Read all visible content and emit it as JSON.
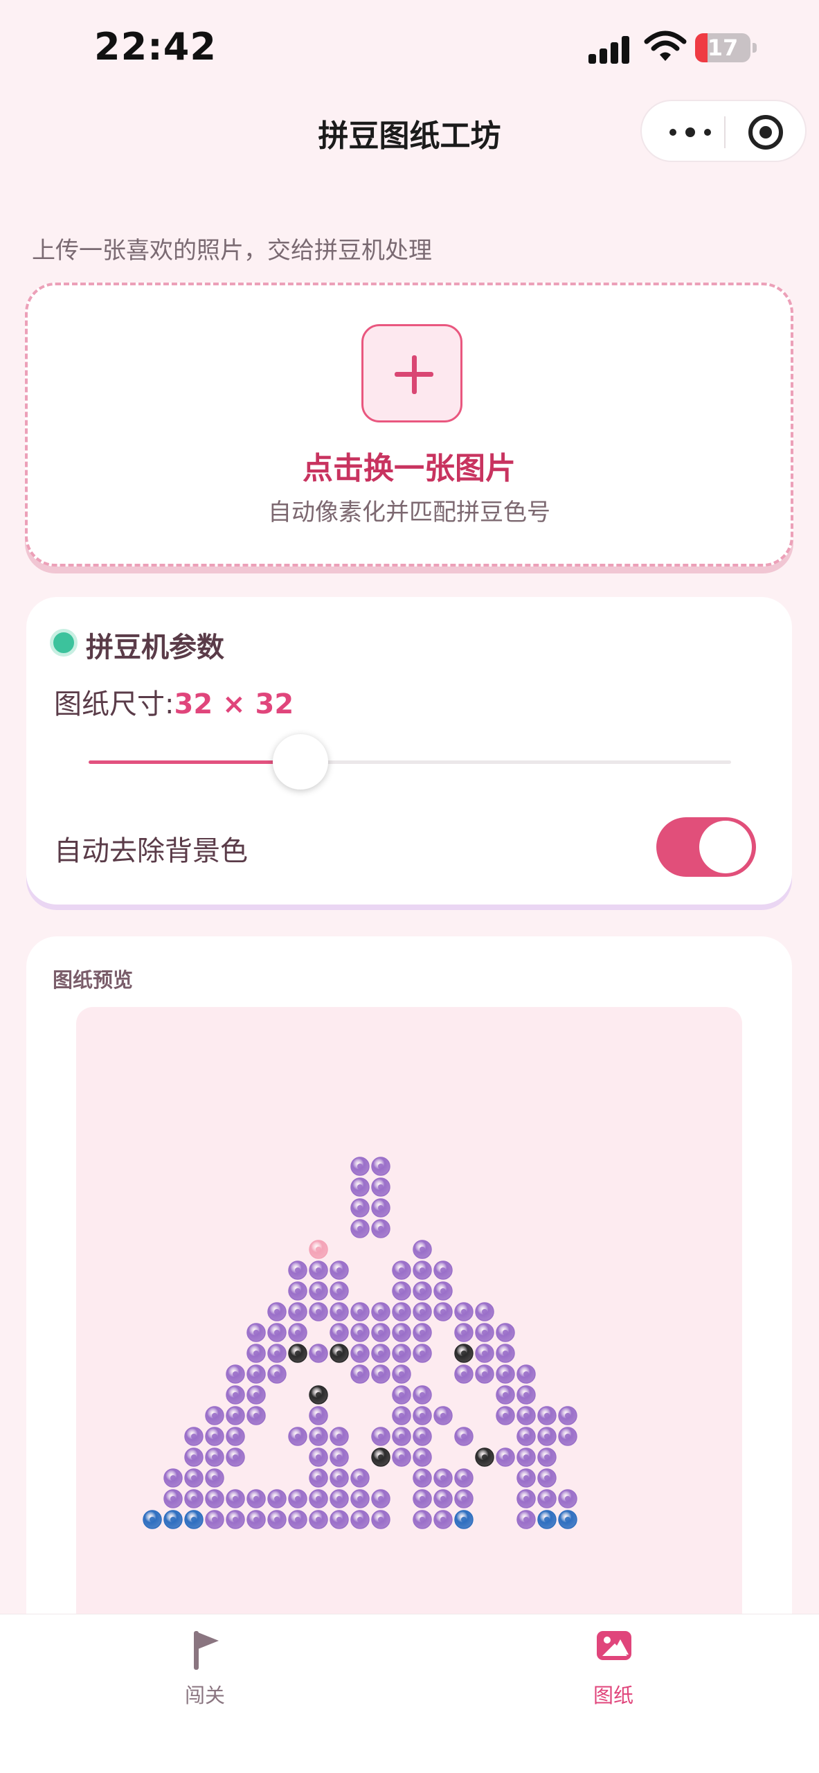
{
  "status_bar": {
    "time": "22:42",
    "battery_level": "17"
  },
  "nav": {
    "title": "拼豆图纸工坊",
    "more_icon": "more-dots-icon",
    "close_icon": "target-circle-icon"
  },
  "hint": "上传一张喜欢的照片，交给拼豆机处理",
  "upload": {
    "title": "点击换一张图片",
    "subtitle": "自动像素化并匹配拼豆色号"
  },
  "params": {
    "title": "拼豆机参数",
    "size_label": "图纸尺寸:",
    "size_value": "32 × 32",
    "size_slider_fraction": 0.33,
    "remove_bg_label": "自动去除背景色",
    "remove_bg_enabled": true
  },
  "preview": {
    "label": "图纸预览",
    "palette": {
      "P": "#9a6fc9",
      "B": "#2f6fc0",
      "K": "#2b2b2b",
      "R": "#f4a3b7"
    },
    "grid": [
      "..........PP..........",
      "..........PP..........",
      "..........PP..........",
      "..........PP..........",
      "........R....P........",
      ".......PPP..PPP.......",
      ".......PPP..PPP.......",
      "......PPPPPPPPPPP.....",
      ".....PPP.PPPPP.PPP....",
      ".....PPKPKPPPP.KPP....",
      "....PPP...PPP..PPPP...",
      "....PP..K...PP...PP...",
      "...PPP..P...PPP..PPPP.",
      "..PPP..PPP.PPP.P..PPP.",
      "..PPP...PP.KPP..KPPP..",
      ".PPP....PPP..PPP..PP..",
      ".PPPPPPPPPPP.PPP..PPP.",
      "BBBPPPPPPPPP.PPB..PBB."
    ]
  },
  "tabs": {
    "levels_label": "闯关",
    "levels_icon": "flag-icon",
    "patterns_label": "图纸",
    "patterns_icon": "image-icon"
  }
}
